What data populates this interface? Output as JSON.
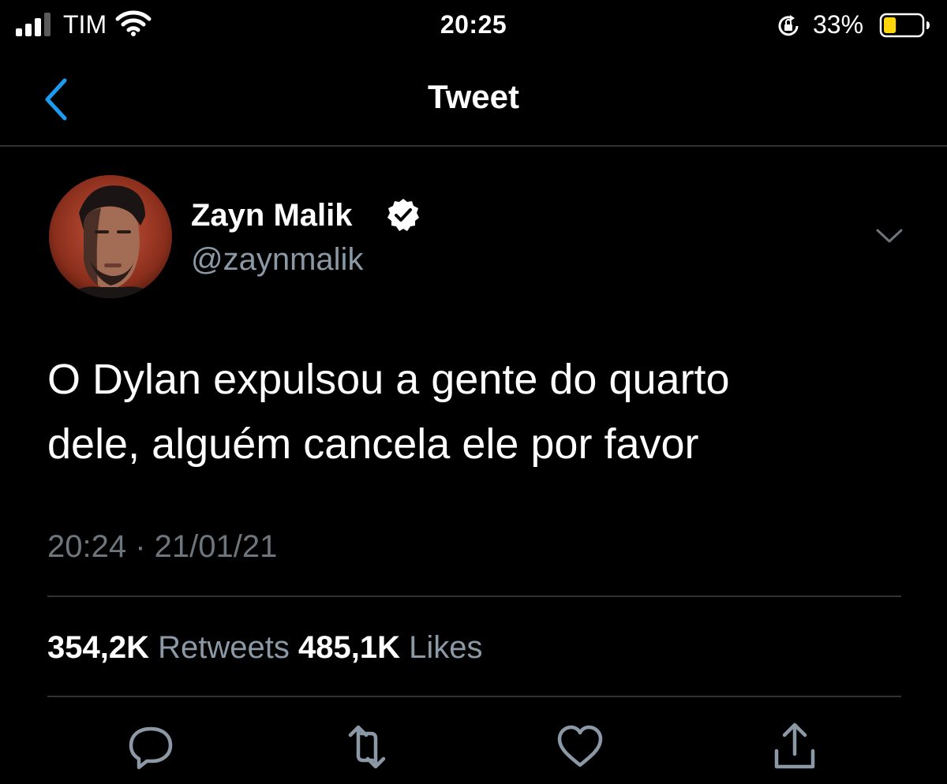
{
  "status_bar": {
    "carrier": "TIM",
    "time": "20:25",
    "battery_percent": "33%",
    "battery_level": 0.33,
    "icons": [
      "signal-icon",
      "wifi-icon",
      "rotation-lock-icon",
      "battery-icon"
    ]
  },
  "nav": {
    "title": "Tweet",
    "back_icon": "chevron-left-icon"
  },
  "tweet": {
    "author_name": "Zayn Malik",
    "handle": "@zaynmalik",
    "verified": true,
    "text": "O Dylan expulsou a gente do quarto\ndele, alguém cancela ele por favor",
    "timestamp": "20:24 · 21/01/21",
    "retweets_count": "354,2K",
    "retweets_label": "Retweets",
    "likes_count": "485,1K",
    "likes_label": "Likes"
  },
  "actions": [
    "reply-icon",
    "retweet-icon",
    "like-icon",
    "share-icon"
  ],
  "colors": {
    "background": "#000000",
    "text": "#ffffff",
    "secondary_text": "#8b98a5",
    "divider": "#2f3336",
    "accent": "#1d9bf0",
    "battery_fill": "#ffd60a"
  }
}
